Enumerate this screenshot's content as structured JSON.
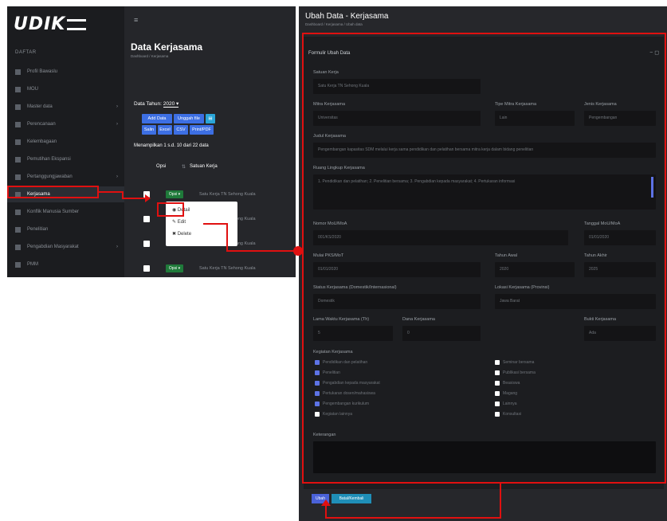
{
  "left": {
    "logo": "UDIK",
    "menu_heading": "DAFTAR",
    "nav": [
      {
        "label": "Profil Bawaslu",
        "has_arrow": false
      },
      {
        "label": "MOU",
        "has_arrow": false
      },
      {
        "label": "Master data",
        "has_arrow": true
      },
      {
        "label": "Perencanaan",
        "has_arrow": true
      },
      {
        "label": "Kelembagaan",
        "has_arrow": false
      },
      {
        "label": "Pemutihan Ekspansi",
        "has_arrow": false
      },
      {
        "label": "Pertanggungjawaban",
        "has_arrow": true
      },
      {
        "label": "Kerjasama",
        "has_arrow": false,
        "active": true
      },
      {
        "label": "Konflik Manusia Sumber",
        "has_arrow": false
      },
      {
        "label": "Penelitian",
        "has_arrow": false
      },
      {
        "label": "Pengabdian Masyarakat",
        "has_arrow": true
      },
      {
        "label": "PMM",
        "has_arrow": false
      }
    ],
    "page_title": "Data Kerjasama",
    "breadcrumb": "Dashboard / Kerjasama",
    "filter_label": "Data Tahun:",
    "filter_value": "2020 ▾",
    "buttons_row1": [
      "Add Data",
      "Unggah file"
    ],
    "buttons_row2": [
      "Salin",
      "Excel",
      "CSV",
      "Print/PDF"
    ],
    "info": "Menampilkan 1 s.d. 10 dari 22 data",
    "col_opsi": "Opsi",
    "col_satuan": "Satuan Kerja",
    "opsi_label": "Opsi ▾",
    "rows": [
      "Satu Kerja TN Sehong Kuala",
      "Satu Kerja TN Sehong Kuala",
      "Satu Kerja TN Sehong Kuala",
      "Satu Kerja TN Sehong Kuala"
    ],
    "dropdown": [
      "Detail",
      "Edit",
      "Delete"
    ]
  },
  "right": {
    "title": "Ubah Data - Kerjasama",
    "breadcrumb": "Dashboard / Kerjasama / Ubah data",
    "card_title": "Formulir Ubah Data",
    "fields": {
      "satuan_kerja_label": "Satuan Kerja",
      "satuan_kerja_value": "Satu Kerja TN Sehong Kuala",
      "mitra_label": "Mitra Kerjasama",
      "mitra_value": "Universitas",
      "tipe_label": "Tipe Mitra Kerjasama",
      "tipe_value": "Lain",
      "jenis_label": "Jenis Kerjasama",
      "jenis_value": "Pengembangan",
      "judul_label": "Judul Kerjasama",
      "judul_value": "Pengembangan kapasitas SDM melalui kerja sama pendidikan dan pelatihan bersama mitra kerja dalam bidang penelitian",
      "ruang_label": "Ruang Lingkup Kerjasama",
      "ruang_value": "1. Pendidikan dan pelatihan; 2. Penelitian bersama; 3. Pengabdian kepada masyarakat; 4. Pertukaran informasi",
      "nomor_label": "Nomor MoU/MoA",
      "nomor_value": "001/KS/2020",
      "tanggal_label": "Tanggal MoU/MoA",
      "tanggal_value": "01/01/2020",
      "mulai_label": "Mulai PKS/MoT",
      "mulai_value": "01/01/2020",
      "tahun_awal_label": "Tahun Awal",
      "tahun_awal_value": "2020",
      "tahun_akhir_label": "Tahun Akhir",
      "tahun_akhir_value": "2025",
      "status_label": "Status Kerjasama (Domestik/Internasional)",
      "status_value": "Domestik",
      "lokasi_label": "Lokasi Kerjasama (Provinsi)",
      "lokasi_value": "Jawa Barat",
      "durasi_label": "Lama Waktu Kerjasama (Th)",
      "durasi_value": "5",
      "dana_label": "Dana Kerjasama",
      "dana_value": "0",
      "bukti_label": "Bukti Kerjasama",
      "bukti_value": "Ada",
      "kegiatan_label": "Kegiatan Kerjasama",
      "checks_left": [
        {
          "label": "Pendidikan dan pelatihan",
          "on": true
        },
        {
          "label": "Penelitian",
          "on": true
        },
        {
          "label": "Pengabdian kepada masyarakat",
          "on": true
        },
        {
          "label": "Pertukaran dosen/mahasiswa",
          "on": true
        },
        {
          "label": "Pengembangan kurikulum",
          "on": true
        },
        {
          "label": "Kegiatan lainnya",
          "on": false
        }
      ],
      "checks_right": [
        {
          "label": "Seminar bersama",
          "on": false
        },
        {
          "label": "Publikasi bersama",
          "on": false
        },
        {
          "label": "Beasiswa",
          "on": false
        },
        {
          "label": "Magang",
          "on": false
        },
        {
          "label": "Lainnya",
          "on": false
        },
        {
          "label": "Konsultasi",
          "on": false
        }
      ],
      "keterangan_label": "Keterangan"
    },
    "save_label": "Ubah",
    "cancel_label": "Batal/Kembali"
  },
  "colors": {
    "accent": "#3d6fe3",
    "callout": "#e01010",
    "success": "#1f7a3a"
  }
}
